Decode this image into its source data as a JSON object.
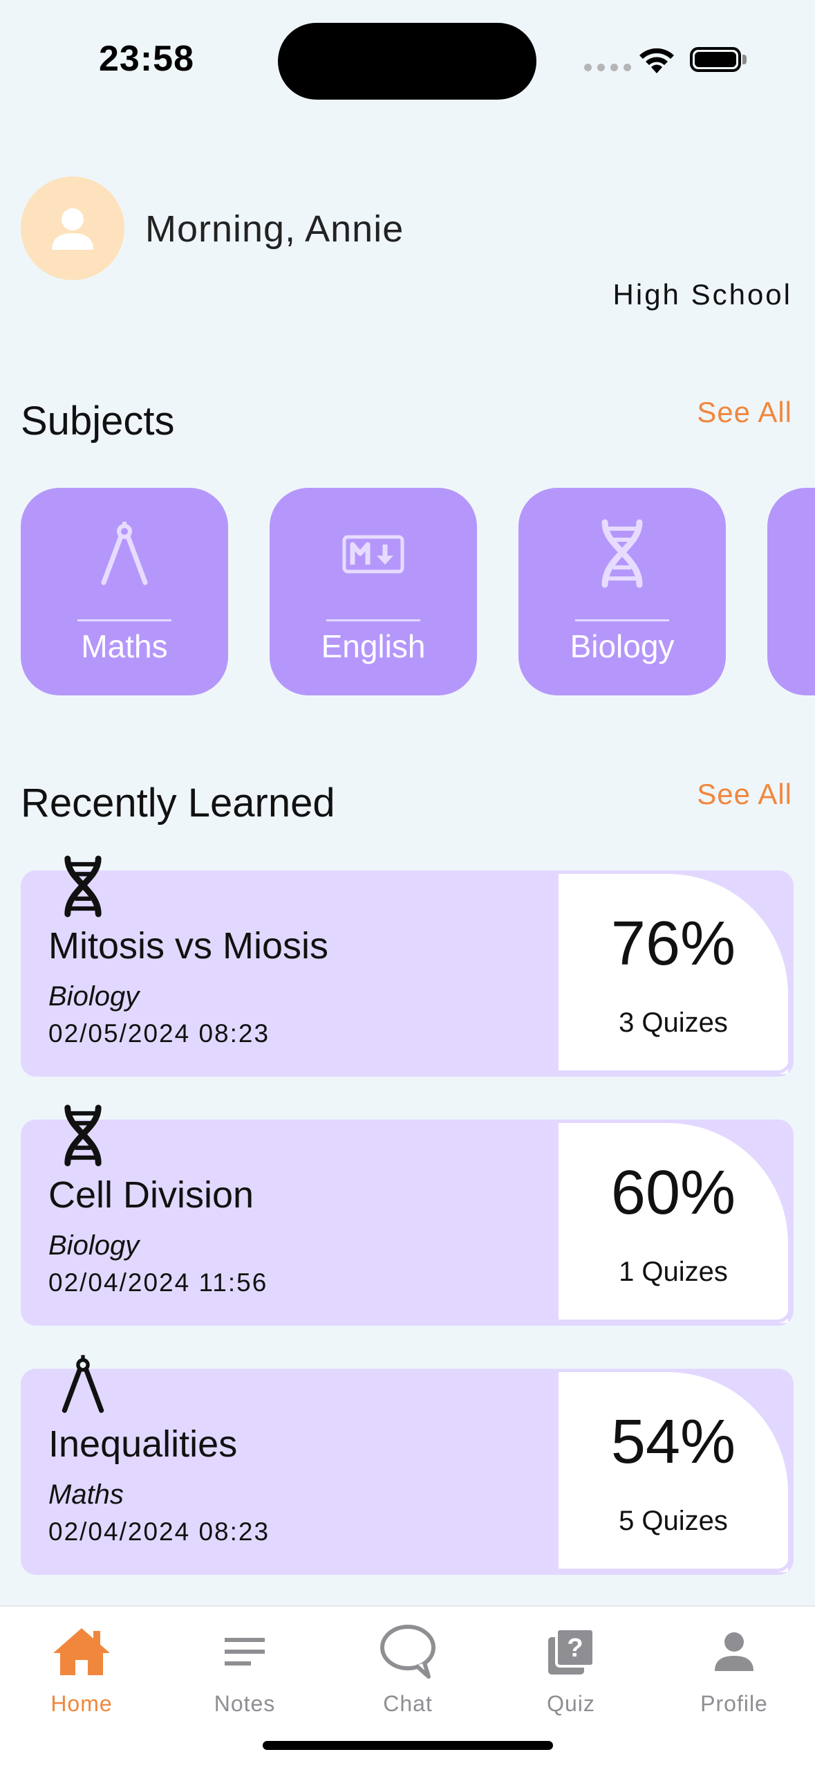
{
  "status_bar": {
    "time": "23:58"
  },
  "header": {
    "greeting": "Morning, Annie",
    "level": "High School"
  },
  "subjects_section": {
    "title": "Subjects",
    "see_all": "See All",
    "items": [
      {
        "label": "Maths",
        "icon": "compass-icon"
      },
      {
        "label": "English",
        "icon": "markdown-icon"
      },
      {
        "label": "Biology",
        "icon": "dna-icon"
      }
    ]
  },
  "recent_section": {
    "title": "Recently Learned",
    "see_all": "See All",
    "items": [
      {
        "topic": "Mitosis vs Miosis",
        "subject": "Biology",
        "date": "02/05/2024 08:23",
        "score": "76%",
        "quizzes": "3 Quizes",
        "icon": "dna-icon"
      },
      {
        "topic": "Cell Division",
        "subject": "Biology",
        "date": "02/04/2024 11:56",
        "score": "60%",
        "quizzes": "1 Quizes",
        "icon": "dna-icon"
      },
      {
        "topic": "Inequalities",
        "subject": "Maths",
        "date": "02/04/2024 08:23",
        "score": "54%",
        "quizzes": "5 Quizes",
        "icon": "compass-icon"
      }
    ]
  },
  "tab_bar": {
    "items": [
      {
        "label": "Home",
        "icon": "home-icon",
        "active": true
      },
      {
        "label": "Notes",
        "icon": "notes-icon",
        "active": false
      },
      {
        "label": "Chat",
        "icon": "chat-icon",
        "active": false
      },
      {
        "label": "Quiz",
        "icon": "quiz-icon",
        "active": false
      },
      {
        "label": "Profile",
        "icon": "profile-icon",
        "active": false
      }
    ]
  },
  "colors": {
    "background": "#eff6fa",
    "accent": "#f0873d",
    "subject_card": "#b597fb",
    "recent_card": "#e2d8ff",
    "avatar": "#fde2bd"
  }
}
